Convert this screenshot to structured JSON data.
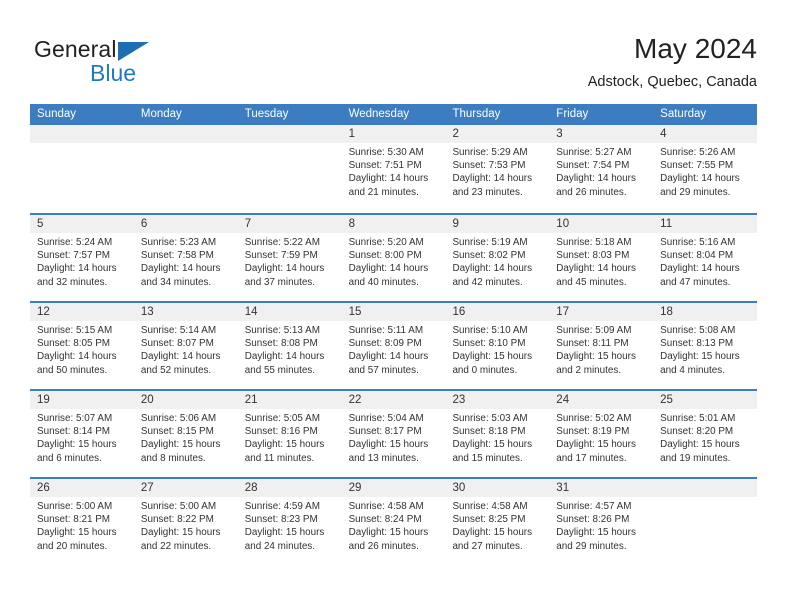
{
  "brand": {
    "name_part1": "General",
    "name_part2": "Blue",
    "triangle_color": "#1f6eb5",
    "blue_color": "#1f7ac4"
  },
  "header": {
    "title": "May 2024",
    "subtitle": "Adstock, Quebec, Canada"
  },
  "theme": {
    "header_blue": "#3b7dc0",
    "daynum_band": "#f0f0f0",
    "text": "#333333"
  },
  "weekdays": [
    "Sunday",
    "Monday",
    "Tuesday",
    "Wednesday",
    "Thursday",
    "Friday",
    "Saturday"
  ],
  "weeks": [
    [
      {
        "day": "",
        "lines": []
      },
      {
        "day": "",
        "lines": []
      },
      {
        "day": "",
        "lines": []
      },
      {
        "day": "1",
        "lines": [
          "Sunrise: 5:30 AM",
          "Sunset: 7:51 PM",
          "Daylight: 14 hours",
          "and 21 minutes."
        ]
      },
      {
        "day": "2",
        "lines": [
          "Sunrise: 5:29 AM",
          "Sunset: 7:53 PM",
          "Daylight: 14 hours",
          "and 23 minutes."
        ]
      },
      {
        "day": "3",
        "lines": [
          "Sunrise: 5:27 AM",
          "Sunset: 7:54 PM",
          "Daylight: 14 hours",
          "and 26 minutes."
        ]
      },
      {
        "day": "4",
        "lines": [
          "Sunrise: 5:26 AM",
          "Sunset: 7:55 PM",
          "Daylight: 14 hours",
          "and 29 minutes."
        ]
      }
    ],
    [
      {
        "day": "5",
        "lines": [
          "Sunrise: 5:24 AM",
          "Sunset: 7:57 PM",
          "Daylight: 14 hours",
          "and 32 minutes."
        ]
      },
      {
        "day": "6",
        "lines": [
          "Sunrise: 5:23 AM",
          "Sunset: 7:58 PM",
          "Daylight: 14 hours",
          "and 34 minutes."
        ]
      },
      {
        "day": "7",
        "lines": [
          "Sunrise: 5:22 AM",
          "Sunset: 7:59 PM",
          "Daylight: 14 hours",
          "and 37 minutes."
        ]
      },
      {
        "day": "8",
        "lines": [
          "Sunrise: 5:20 AM",
          "Sunset: 8:00 PM",
          "Daylight: 14 hours",
          "and 40 minutes."
        ]
      },
      {
        "day": "9",
        "lines": [
          "Sunrise: 5:19 AM",
          "Sunset: 8:02 PM",
          "Daylight: 14 hours",
          "and 42 minutes."
        ]
      },
      {
        "day": "10",
        "lines": [
          "Sunrise: 5:18 AM",
          "Sunset: 8:03 PM",
          "Daylight: 14 hours",
          "and 45 minutes."
        ]
      },
      {
        "day": "11",
        "lines": [
          "Sunrise: 5:16 AM",
          "Sunset: 8:04 PM",
          "Daylight: 14 hours",
          "and 47 minutes."
        ]
      }
    ],
    [
      {
        "day": "12",
        "lines": [
          "Sunrise: 5:15 AM",
          "Sunset: 8:05 PM",
          "Daylight: 14 hours",
          "and 50 minutes."
        ]
      },
      {
        "day": "13",
        "lines": [
          "Sunrise: 5:14 AM",
          "Sunset: 8:07 PM",
          "Daylight: 14 hours",
          "and 52 minutes."
        ]
      },
      {
        "day": "14",
        "lines": [
          "Sunrise: 5:13 AM",
          "Sunset: 8:08 PM",
          "Daylight: 14 hours",
          "and 55 minutes."
        ]
      },
      {
        "day": "15",
        "lines": [
          "Sunrise: 5:11 AM",
          "Sunset: 8:09 PM",
          "Daylight: 14 hours",
          "and 57 minutes."
        ]
      },
      {
        "day": "16",
        "lines": [
          "Sunrise: 5:10 AM",
          "Sunset: 8:10 PM",
          "Daylight: 15 hours",
          "and 0 minutes."
        ]
      },
      {
        "day": "17",
        "lines": [
          "Sunrise: 5:09 AM",
          "Sunset: 8:11 PM",
          "Daylight: 15 hours",
          "and 2 minutes."
        ]
      },
      {
        "day": "18",
        "lines": [
          "Sunrise: 5:08 AM",
          "Sunset: 8:13 PM",
          "Daylight: 15 hours",
          "and 4 minutes."
        ]
      }
    ],
    [
      {
        "day": "19",
        "lines": [
          "Sunrise: 5:07 AM",
          "Sunset: 8:14 PM",
          "Daylight: 15 hours",
          "and 6 minutes."
        ]
      },
      {
        "day": "20",
        "lines": [
          "Sunrise: 5:06 AM",
          "Sunset: 8:15 PM",
          "Daylight: 15 hours",
          "and 8 minutes."
        ]
      },
      {
        "day": "21",
        "lines": [
          "Sunrise: 5:05 AM",
          "Sunset: 8:16 PM",
          "Daylight: 15 hours",
          "and 11 minutes."
        ]
      },
      {
        "day": "22",
        "lines": [
          "Sunrise: 5:04 AM",
          "Sunset: 8:17 PM",
          "Daylight: 15 hours",
          "and 13 minutes."
        ]
      },
      {
        "day": "23",
        "lines": [
          "Sunrise: 5:03 AM",
          "Sunset: 8:18 PM",
          "Daylight: 15 hours",
          "and 15 minutes."
        ]
      },
      {
        "day": "24",
        "lines": [
          "Sunrise: 5:02 AM",
          "Sunset: 8:19 PM",
          "Daylight: 15 hours",
          "and 17 minutes."
        ]
      },
      {
        "day": "25",
        "lines": [
          "Sunrise: 5:01 AM",
          "Sunset: 8:20 PM",
          "Daylight: 15 hours",
          "and 19 minutes."
        ]
      }
    ],
    [
      {
        "day": "26",
        "lines": [
          "Sunrise: 5:00 AM",
          "Sunset: 8:21 PM",
          "Daylight: 15 hours",
          "and 20 minutes."
        ]
      },
      {
        "day": "27",
        "lines": [
          "Sunrise: 5:00 AM",
          "Sunset: 8:22 PM",
          "Daylight: 15 hours",
          "and 22 minutes."
        ]
      },
      {
        "day": "28",
        "lines": [
          "Sunrise: 4:59 AM",
          "Sunset: 8:23 PM",
          "Daylight: 15 hours",
          "and 24 minutes."
        ]
      },
      {
        "day": "29",
        "lines": [
          "Sunrise: 4:58 AM",
          "Sunset: 8:24 PM",
          "Daylight: 15 hours",
          "and 26 minutes."
        ]
      },
      {
        "day": "30",
        "lines": [
          "Sunrise: 4:58 AM",
          "Sunset: 8:25 PM",
          "Daylight: 15 hours",
          "and 27 minutes."
        ]
      },
      {
        "day": "31",
        "lines": [
          "Sunrise: 4:57 AM",
          "Sunset: 8:26 PM",
          "Daylight: 15 hours",
          "and 29 minutes."
        ]
      },
      {
        "day": "",
        "lines": []
      }
    ]
  ]
}
